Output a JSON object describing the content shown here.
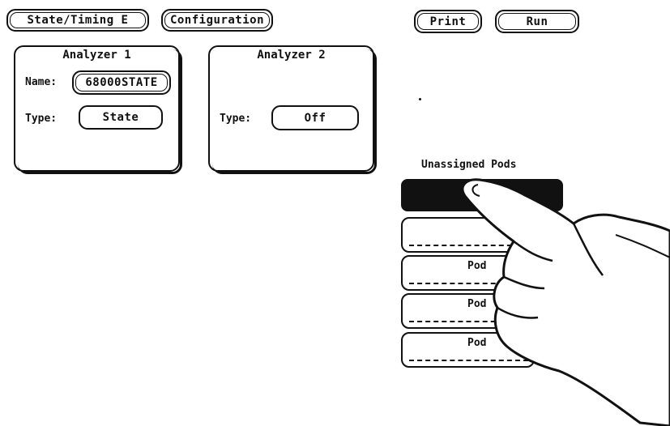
{
  "top_bar": {
    "mode_button": "State/Timing E",
    "config_button": "Configuration",
    "print_button": "Print",
    "run_button": "Run"
  },
  "analyzer1": {
    "title": "Analyzer 1",
    "name_label": "Name:",
    "name_value": "68000STATE",
    "type_label": "Type:",
    "type_value": "State"
  },
  "analyzer2": {
    "title": "Analyzer 2",
    "type_label": "Type:",
    "type_value": "Off"
  },
  "pods": {
    "title": "Unassigned Pods",
    "items": [
      {
        "label": "Pod"
      },
      {
        "label": "Pod"
      },
      {
        "label": "Pod"
      }
    ]
  },
  "colors": {
    "foreground": "#111111",
    "background": "#ffffff"
  }
}
